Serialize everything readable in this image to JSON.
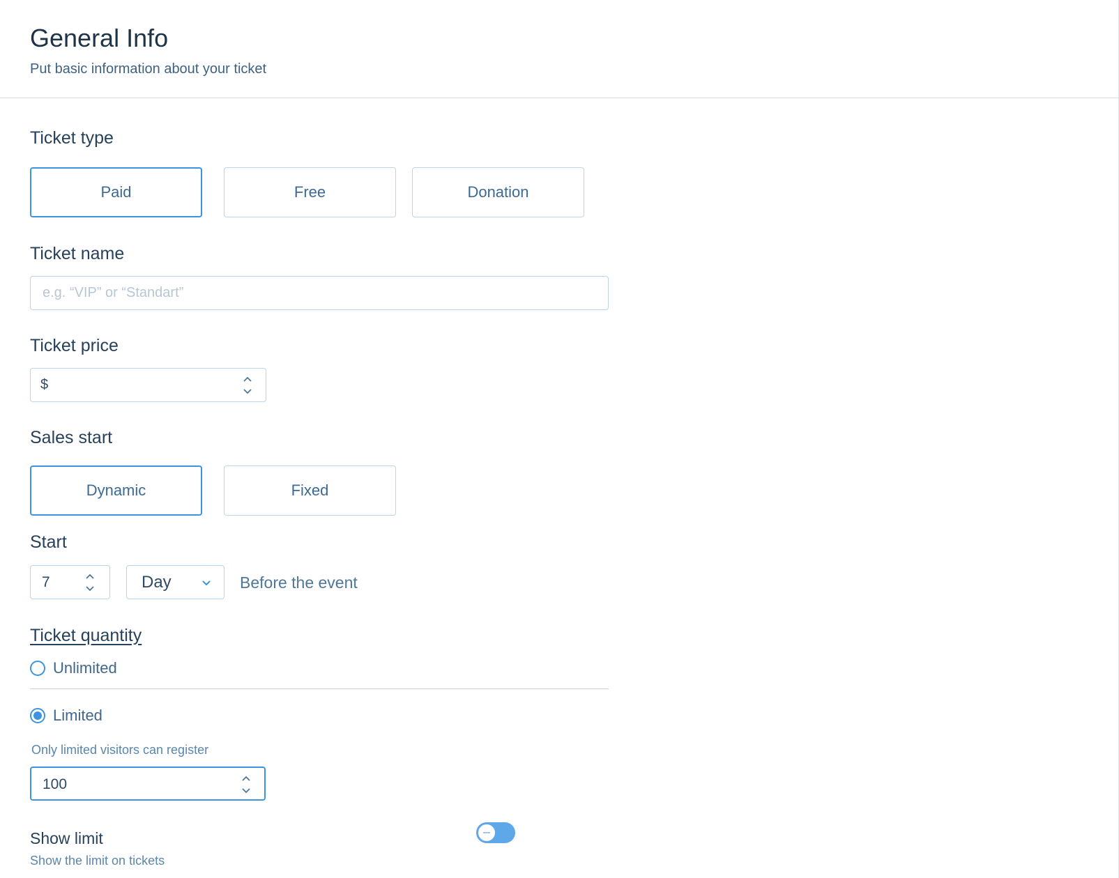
{
  "header": {
    "title": "General Info",
    "subtitle": "Put basic information about your ticket"
  },
  "ticket_type": {
    "label": "Ticket type",
    "options": [
      "Paid",
      "Free",
      "Donation"
    ],
    "selected": "Paid"
  },
  "ticket_name": {
    "label": "Ticket name",
    "placeholder": "e.g. “VIP” or “Standart”",
    "value": ""
  },
  "ticket_price": {
    "label": "Ticket price",
    "prefix": "$",
    "value": ""
  },
  "sales_start": {
    "label": "Sales start",
    "options": [
      "Dynamic",
      "Fixed"
    ],
    "selected": "Dynamic"
  },
  "start": {
    "label": "Start",
    "amount": "7",
    "unit": "Day",
    "suffix": "Before the event"
  },
  "ticket_quantity": {
    "label": "Ticket quantity",
    "unlimited_label": "Unlimited",
    "limited_label": "Limited",
    "selected": "Limited",
    "limited_hint": "Only limited visitors can register",
    "limit_value": "100"
  },
  "show_limit": {
    "label": "Show limit",
    "hint": "Show the limit on tickets",
    "enabled": true
  },
  "colors": {
    "accent": "#3d93df",
    "border": "#b8d4ee",
    "heading": "#27415b"
  }
}
